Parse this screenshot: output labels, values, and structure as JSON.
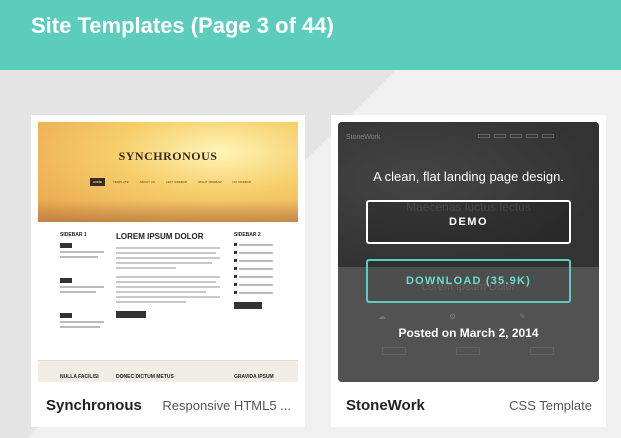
{
  "header": {
    "title": "Site Templates (Page 3 of 44)"
  },
  "colors": {
    "accent": "#5ccdbd",
    "background": "#eaeaea"
  },
  "templates": [
    {
      "name": "Synchronous",
      "meta": "Responsive HTML5 ...",
      "preview": {
        "logo": "SYNCHRONOUS",
        "nav": [
          "HOME",
          "TEMPLATE",
          "ABOUT US",
          "LEFT SIDEBAR",
          "RIGHT SIDEBAR",
          "NO SIDEBAR"
        ],
        "sidebar1_heading": "SIDEBAR 1",
        "main_heading": "LOREM IPSUM DOLOR",
        "sidebar2_heading": "SIDEBAR 2",
        "footer_headings": [
          "NULLA FACILISI",
          "DONEC DICTUM METUS",
          "GRAVIDA IPSUM"
        ]
      }
    },
    {
      "name": "StoneWork",
      "meta": "CSS Template",
      "preview": {
        "logo": "StoneWork",
        "description": "A clean, flat landing page design.",
        "demo_label": "DEMO",
        "download_label": "DOWNLOAD (35.9K)",
        "posted": "Posted on March 2, 2014",
        "ghost_heading": "Maecenas luctus lectus",
        "ghost_heading2": "Lorem Ipsum Dolor"
      }
    }
  ]
}
